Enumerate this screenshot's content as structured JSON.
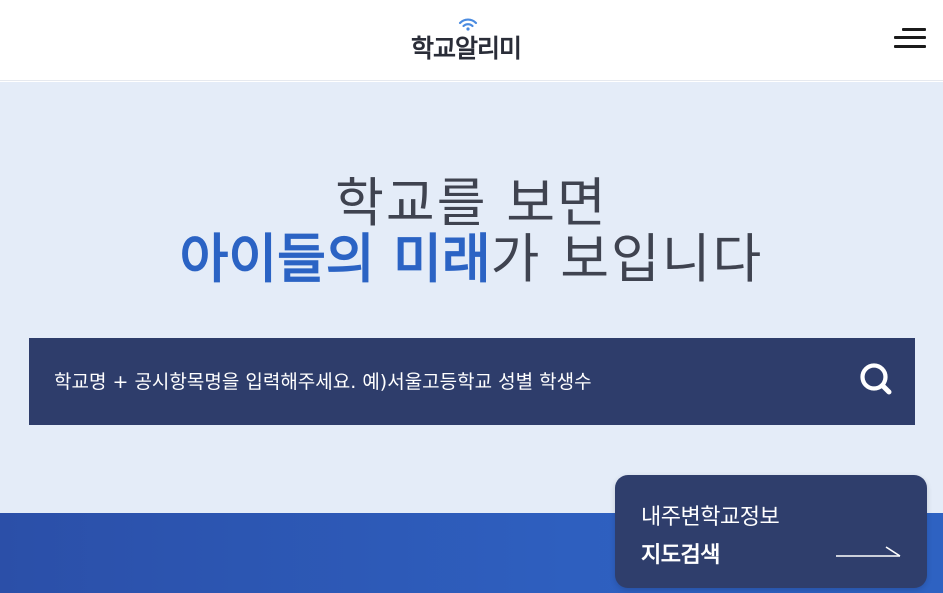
{
  "header": {
    "logo_text": "학교알리미",
    "logo_wave_icon": "wifi-signal-icon",
    "menu_icon": "hamburger-menu-icon"
  },
  "hero": {
    "headline_line1": "학교를 보면",
    "headline_accent": "아이들의 미래",
    "headline_rest": "가 보입니다"
  },
  "search": {
    "placeholder": "학교명 + 공시항목명을 입력해주세요. 예)서울고등학교 성별 학생수",
    "value": "",
    "icon": "search-icon"
  },
  "map_card": {
    "line1": "내주변학교정보",
    "line2": "지도검색",
    "icon": "arrow-right-icon"
  },
  "colors": {
    "hero_bg": "#e4ecf8",
    "accent": "#2b63c4",
    "navy": "#2e3d6b",
    "band": "#2e5fbf"
  }
}
